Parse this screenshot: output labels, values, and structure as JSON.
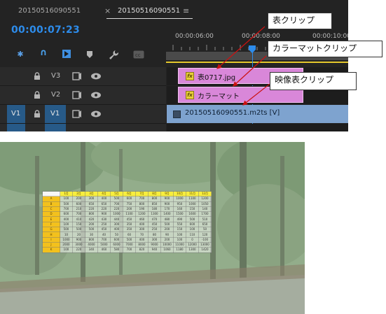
{
  "editor": {
    "tabs": [
      "20150516090551",
      "20150516090551"
    ],
    "tab_close": "×",
    "tab_menu": "≡",
    "timecode": "00:00:07:23",
    "ruler_labels": [
      "00:00:06:00",
      "00:00:08:00",
      "00:00:10:00"
    ],
    "tracks": [
      {
        "source": "",
        "target": "V3"
      },
      {
        "source": "",
        "target": "V2"
      },
      {
        "source": "V1",
        "target": "V1"
      }
    ],
    "clips": {
      "v3": {
        "name": "表0717.jpg",
        "fx": "fx"
      },
      "v2": {
        "name": "カラーマット",
        "fx": "fx"
      },
      "v1": {
        "name": "20150516090551.m2ts [V]"
      }
    },
    "colors": {
      "timecode": "#2d8ceb",
      "graphic_clip": "#d987d9",
      "video_clip": "#7ea3cf",
      "playhead": "#2d8ceb"
    }
  },
  "callouts": [
    "表クリップ",
    "カラーマットクリップ",
    "映像表クリップ"
  ],
  "preview": {
    "columns": [
      "1月",
      "2月",
      "3月",
      "4月",
      "5月",
      "6月",
      "7月",
      "8月",
      "9月",
      "10月",
      "11月",
      "12月"
    ],
    "rows": [
      {
        "label": "A",
        "values": [
          "100",
          "200",
          "300",
          "400",
          "500",
          "600",
          "700",
          "800",
          "900",
          "1000",
          "1100",
          "1200"
        ]
      },
      {
        "label": "B",
        "values": [
          "500",
          "600",
          "650",
          "650",
          "700",
          "750",
          "800",
          "850",
          "900",
          "950",
          "1000",
          "1050"
        ]
      },
      {
        "label": "C",
        "values": [
          "700",
          "210",
          "220",
          "220",
          "220",
          "200",
          "190",
          "180",
          "170",
          "160",
          "150",
          "140"
        ]
      },
      {
        "label": "D",
        "values": [
          "600",
          "700",
          "800",
          "900",
          "1000",
          "1100",
          "1200",
          "1300",
          "1400",
          "1500",
          "1600",
          "1700"
        ]
      },
      {
        "label": "E",
        "values": [
          "400",
          "410",
          "420",
          "430",
          "440",
          "450",
          "460",
          "470",
          "480",
          "490",
          "500",
          "510"
        ]
      },
      {
        "label": "F",
        "values": [
          "100",
          "150",
          "200",
          "250",
          "300",
          "350",
          "400",
          "450",
          "500",
          "550",
          "600",
          "650"
        ]
      },
      {
        "label": "G",
        "values": [
          "500",
          "500",
          "500",
          "450",
          "400",
          "350",
          "300",
          "250",
          "200",
          "150",
          "100",
          "50"
        ]
      },
      {
        "label": "H",
        "values": [
          "10",
          "20",
          "30",
          "40",
          "50",
          "60",
          "70",
          "80",
          "90",
          "100",
          "110",
          "120"
        ]
      },
      {
        "label": "I",
        "values": [
          "1000",
          "900",
          "800",
          "700",
          "600",
          "500",
          "400",
          "300",
          "200",
          "100",
          "0",
          "-100"
        ]
      },
      {
        "label": "J",
        "values": [
          "2000",
          "3000",
          "4000",
          "5000",
          "6000",
          "7000",
          "8000",
          "9000",
          "10000",
          "11000",
          "12000",
          "13000"
        ]
      },
      {
        "label": "K",
        "values": [
          "100",
          "220",
          "340",
          "460",
          "580",
          "700",
          "820",
          "940",
          "1060",
          "1180",
          "1300",
          "1420"
        ]
      }
    ]
  }
}
